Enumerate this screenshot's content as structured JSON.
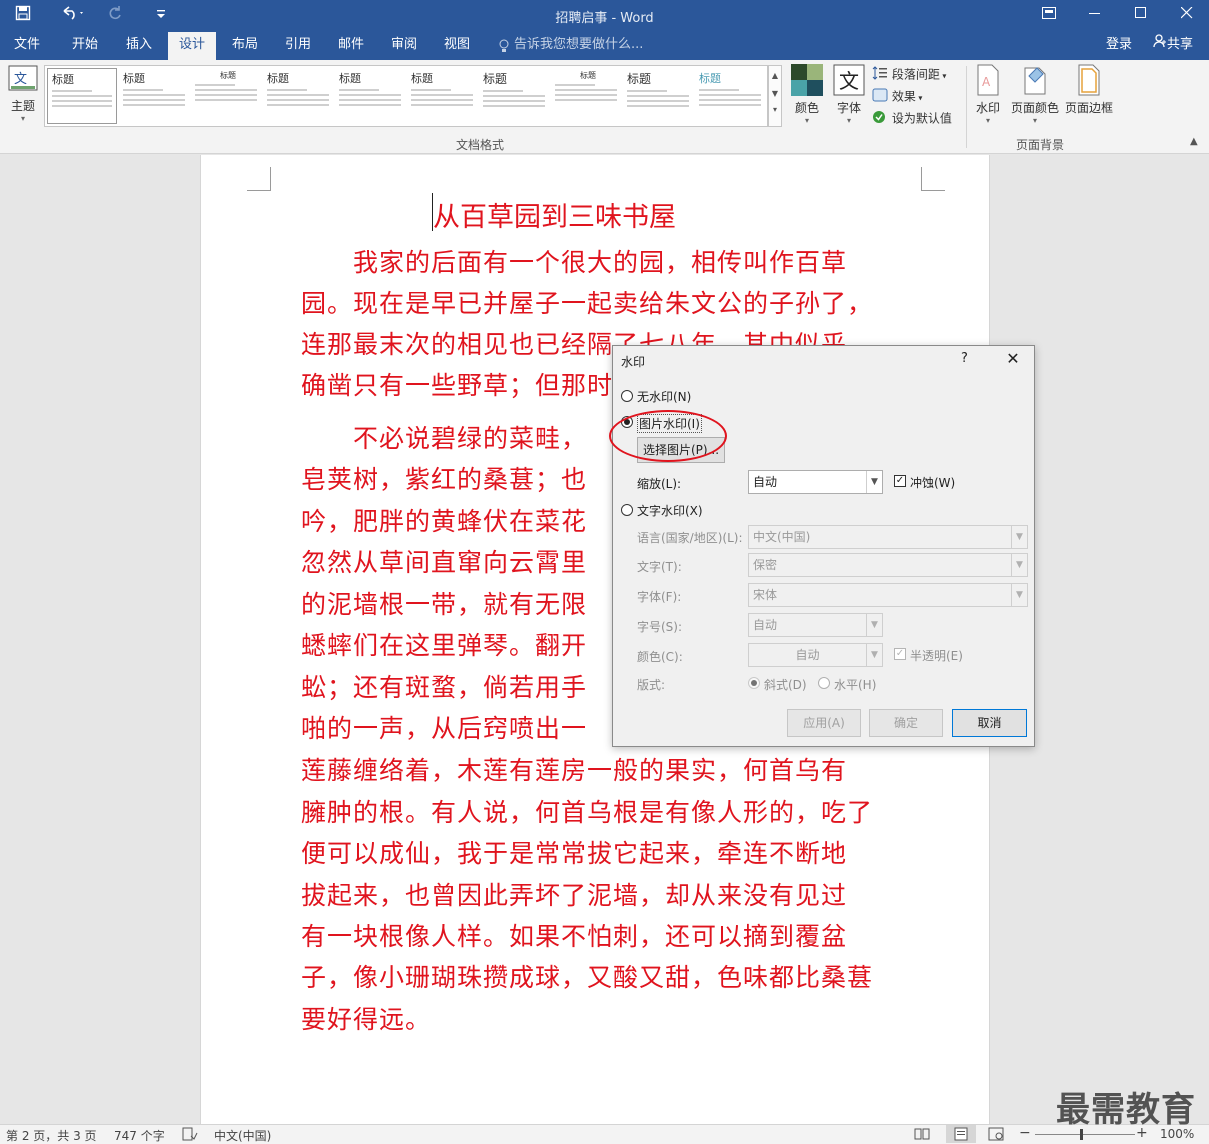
{
  "titlebar": {
    "doc_title": "招聘启事 - Word",
    "save_icon": "save-icon",
    "undo_icon": "undo-icon",
    "redo_icon": "redo-icon"
  },
  "tabs": {
    "items": [
      "文件",
      "开始",
      "插入",
      "设计",
      "布局",
      "引用",
      "邮件",
      "审阅",
      "视图"
    ],
    "active": "设计",
    "tell_me": "告诉我您想要做什么...",
    "login": "登录",
    "share": "共享"
  },
  "ribbon": {
    "theme_label": "主题",
    "gallery_titles": [
      "标题",
      "标题",
      "标题",
      "标题",
      "标题",
      "标题",
      "标题",
      "标题",
      "标题",
      "标题"
    ],
    "colors_label": "颜色",
    "fonts_label": "字体",
    "paragraph_spacing": "段落间距",
    "effects": "效果",
    "set_default": "设为默认值",
    "watermark": "水印",
    "page_color": "页面颜色",
    "page_border": "页面边框",
    "group_doc_format": "文档格式",
    "group_page_bg": "页面背景"
  },
  "document": {
    "title": "从百草园到三味书屋",
    "lines": [
      "　　我家的后面有一个很大的园，相传叫作百草",
      "园。现在是早已并屋子一起卖给朱文公的子孙了，",
      "连那最末次的相见也已经隔了七八年，其中似乎",
      "确凿只有一些野草；但那时",
      "　　不必说碧绿的菜畦，",
      "皂荚树，紫红的桑葚；也",
      "吟，肥胖的黄蜂伏在菜花",
      "忽然从草间直窜向云霄里",
      "的泥墙根一带，就有无限",
      "蟋蟀们在这里弹琴。翻开",
      "蚣；还有斑蝥，倘若用手",
      "啪的一声，从后窍喷出一",
      "莲藤缠络着，木莲有莲房一般的果实，何首乌有",
      "臃肿的根。有人说，何首乌根是有像人形的，吃了",
      "便可以成仙，我于是常常拔它起来，牵连不断地",
      "拔起来，也曾因此弄坏了泥墙，却从来没有见过",
      "有一块根像人样。如果不怕刺，还可以摘到覆盆",
      "子，像小珊瑚珠攒成球，又酸又甜，色味都比桑葚",
      "要好得远。"
    ]
  },
  "dialog": {
    "title": "水印",
    "help": "?",
    "close": "✕",
    "no_watermark": "无水印(N)",
    "picture_watermark": "图片水印(I)",
    "select_picture": "选择图片(P)...",
    "scale_label": "缩放(L):",
    "scale_value": "自动",
    "washout_label": "冲蚀(W)",
    "text_watermark": "文字水印(X)",
    "language_label": "语言(国家/地区)(L):",
    "language_value": "中文(中国)",
    "text_label": "文字(T):",
    "text_value": "保密",
    "font_label": "字体(F):",
    "font_value": "宋体",
    "size_label": "字号(S):",
    "size_value": "自动",
    "color_label": "颜色(C):",
    "color_value": "自动",
    "semitransparent": "半透明(E)",
    "layout_label": "版式:",
    "diagonal": "斜式(D)",
    "horizontal": "水平(H)",
    "apply": "应用(A)",
    "ok": "确定",
    "cancel": "取消"
  },
  "statusbar": {
    "page": "第 2 页，共 3 页",
    "words": "747 个字",
    "language": "中文(中国)",
    "zoom": "100%"
  },
  "brand_watermark": "最需教育",
  "colors": {
    "ribbon_blue": "#2b579a",
    "doc_text_red": "#e0141e",
    "annotation_circle": "#e0141e"
  }
}
